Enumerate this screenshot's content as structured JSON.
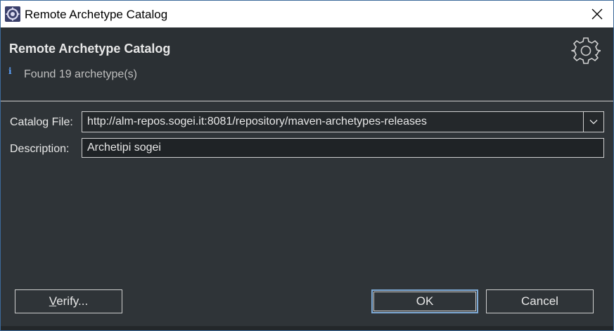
{
  "window": {
    "title": "Remote Archetype Catalog",
    "icon": "eclipse-gear-icon",
    "close_icon": "close-icon"
  },
  "header": {
    "title": "Remote Archetype Catalog",
    "info_icon": "i",
    "message": "Found 19 archetype(s)",
    "banner_icon": "gear-icon"
  },
  "form": {
    "catalog_file_label": "Catalog File:",
    "catalog_file_value": "http://alm-repos.sogei.it:8081/repository/maven-archetypes-releases",
    "description_label": "Description:",
    "description_value": "Archetipi sogei"
  },
  "buttons": {
    "verify_prefix": "V",
    "verify_rest": "erify...",
    "ok": "OK",
    "cancel": "Cancel"
  },
  "colors": {
    "background": "#2f3438",
    "header_background": "#2b3034",
    "text": "#e8e8e8",
    "info_blue": "#5da3ff",
    "default_button_border": "#7eaad6"
  }
}
